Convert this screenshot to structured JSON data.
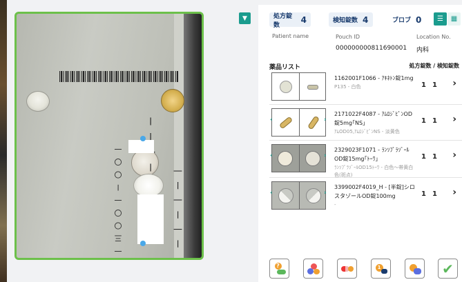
{
  "header": {
    "prescription_count": {
      "label": "処方錠数",
      "value": "4"
    },
    "audit_count": {
      "label": "検知錠数",
      "value": "4"
    },
    "blob_count": {
      "label": "ブロブ",
      "value": "0"
    }
  },
  "patient": {
    "name_label": "Patient name",
    "pouch_label": "Pouch ID",
    "pouch_value": "000000000811690001",
    "location_label": "Location No.",
    "location_value": "内科"
  },
  "list": {
    "title": "薬品リスト",
    "legend": "処方錠数 / 検知錠数",
    "rows": [
      {
        "name": "1162001F1066 - ｱｷﾈﾄﾝ錠1mg",
        "sub": "P135 - 白色",
        "rx": "1",
        "detected": "1"
      },
      {
        "name": "2171022F4087 - ｱﾑﾛｼﾞﾋﾟﾝOD錠5mg｢NS｣",
        "sub": "ｱﾑOD05,ｱﾑﾛｼﾞﾋﾟﾝNS - 淡黄色",
        "rx": "1",
        "detected": "1"
      },
      {
        "name": "2329023F1071 - ﾗﾝｿﾌﾟﾗｿﾞｰﾙOD錠15mg｢ﾄｰﾜ｣",
        "sub": "ﾗﾝｿﾌﾟﾗｿﾞｰﾙOD15ﾄｰﾜ - 白色～帯黄白色(斑点)",
        "rx": "1",
        "detected": "1"
      },
      {
        "name": "3399002F4019_H - [半錠]シロスタゾールOD錠100mg",
        "sub": "-",
        "rx": "1",
        "detected": "1"
      }
    ]
  },
  "toolbar": {
    "icons": [
      "question-pill-icon",
      "multi-pill-icon",
      "capsule-pill-icon",
      "count-pill-icon",
      "pill-no-icon",
      "confirm-check-icon"
    ]
  },
  "colors": {
    "accent": "#1b9c8e",
    "frame": "#6cc04a",
    "chip_bg": "#eaf0f7",
    "chip_text": "#1a3c6e",
    "check": "#5cb85c"
  }
}
